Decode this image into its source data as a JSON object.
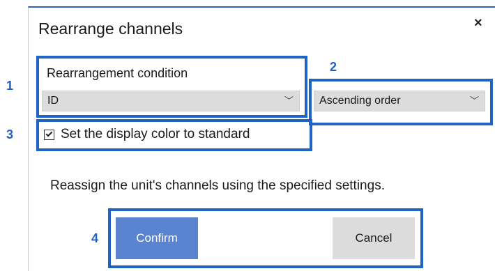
{
  "dialog": {
    "title": "Rearrange channels",
    "close_symbol": "×"
  },
  "condition": {
    "label": "Rearrangement condition",
    "selected_value": "ID",
    "chevron": "﹀"
  },
  "order": {
    "selected_value": "Ascending order",
    "chevron": "﹀"
  },
  "display_color": {
    "label": "Set the display color to standard",
    "checked": true
  },
  "message": "Reassign the unit's channels using the specified settings.",
  "buttons": {
    "confirm_label": "Confirm",
    "cancel_label": "Cancel"
  },
  "annotations": [
    "1",
    "2",
    "3",
    "4"
  ],
  "colors": {
    "annotation_blue": "#1f64c4",
    "confirm_bg": "#5b84d0",
    "dropdown_bg": "#dcdcdc",
    "title_bar_accent": "#2e62b7"
  }
}
